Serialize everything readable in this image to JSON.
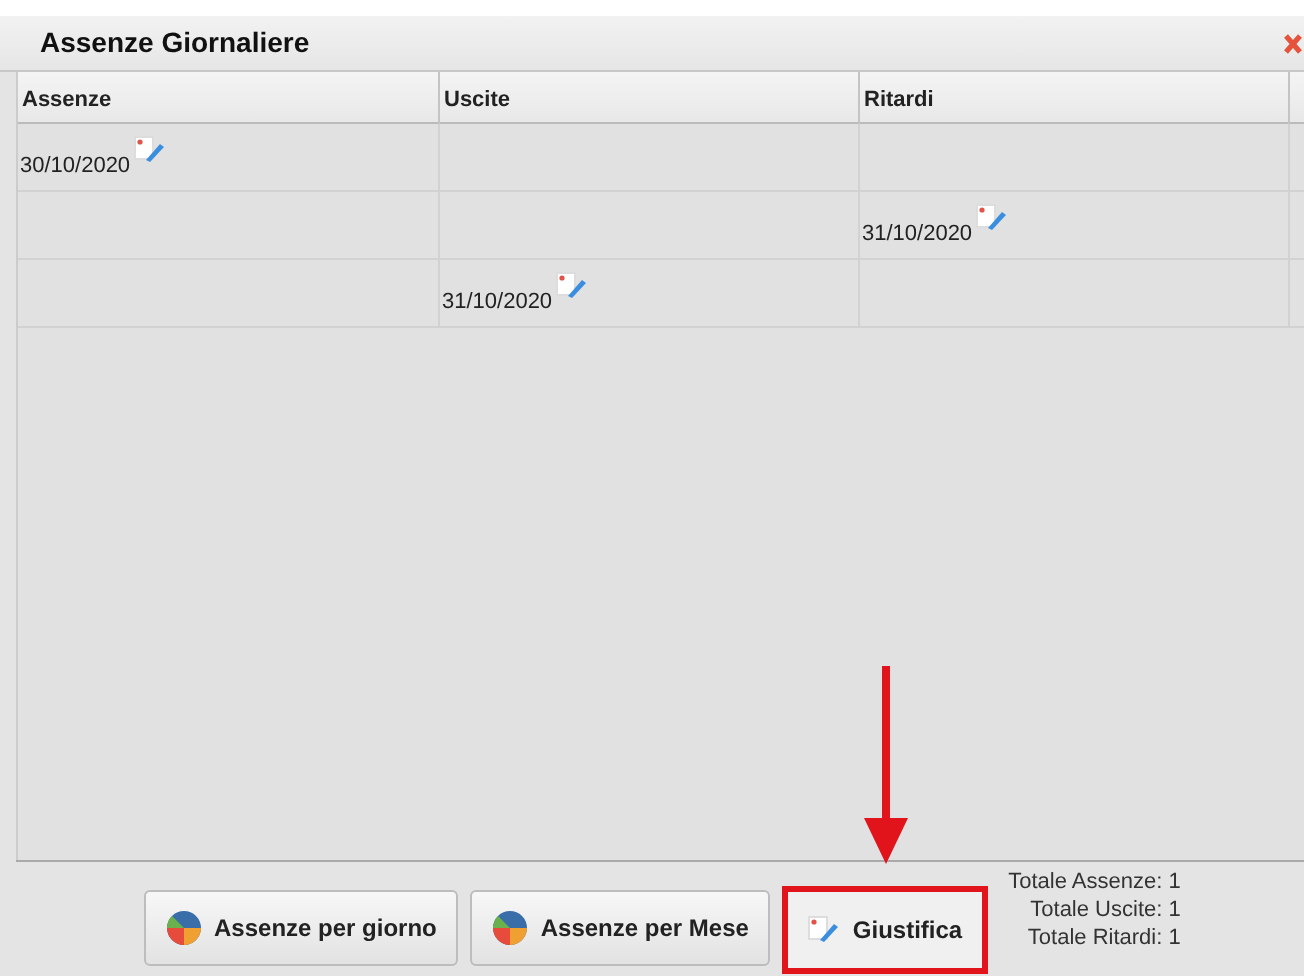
{
  "window": {
    "title": "Assenze Giornaliere"
  },
  "table": {
    "columns": [
      {
        "label": "Assenze"
      },
      {
        "label": "Uscite"
      },
      {
        "label": "Ritardi"
      }
    ],
    "rows": [
      {
        "cells": [
          "30/10/2020",
          null,
          null
        ]
      },
      {
        "cells": [
          null,
          null,
          "31/10/2020"
        ]
      },
      {
        "cells": [
          null,
          "31/10/2020",
          null
        ]
      }
    ]
  },
  "buttons": [
    {
      "kind": "chart",
      "label": "Assenze per giorno",
      "highlighted": false
    },
    {
      "kind": "chart",
      "label": "Assenze per Mese",
      "highlighted": false
    },
    {
      "kind": "justify",
      "label": "Giustifica",
      "highlighted": true
    }
  ],
  "totals": [
    "Totale Assenze: 1",
    "Totale Uscite: 1",
    "Totale Ritardi: 1"
  ]
}
